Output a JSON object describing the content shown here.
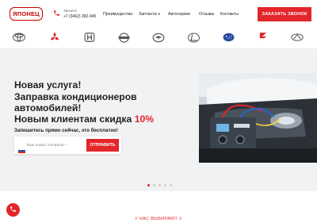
{
  "header": {
    "logo_text": "ЯПОНЕЦ",
    "call_label": "Звоните",
    "phone": "+7 (3462) 382-945",
    "nav": [
      {
        "label": "Преимущества",
        "dropdown": false
      },
      {
        "label": "Запчасти",
        "dropdown": true
      },
      {
        "label": "Автосервис",
        "dropdown": false
      },
      {
        "label": "Отзывы",
        "dropdown": false
      },
      {
        "label": "Контакты",
        "dropdown": false
      }
    ],
    "order_button": "ЗАКАЗАТЬ ЗВОНОК"
  },
  "brands": [
    "toyota-logo",
    "mitsubishi-logo",
    "honda-logo",
    "nissan-logo",
    "mazda-logo",
    "lexus-logo",
    "subaru-logo",
    "suzuki-logo",
    "infiniti-logo"
  ],
  "hero": {
    "lines": [
      "Новая услуга!",
      "Заправка кондиционеров",
      "автомобилей!",
      "Новым клиентам скидка "
    ],
    "discount": "10%",
    "subtitle": "Запишитесь прямо сейчас, это бесплатно!",
    "input_placeholder": "Ваш номер телефона *",
    "submit_button": "ОТПРАВИТЬ",
    "slides_total": 5,
    "slide_active": 1
  },
  "section_title": "// НАС ВЫБИРАЮТ //",
  "colors": {
    "accent": "#e3262b",
    "hero_bg": "#f1f2f4"
  }
}
